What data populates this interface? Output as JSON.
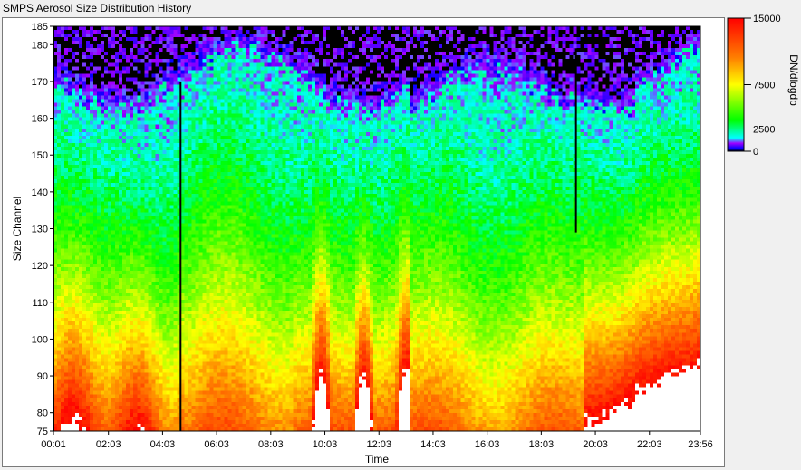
{
  "window": {
    "title": "SMPS Aerosol Size Distribution History"
  },
  "chart_data": {
    "type": "heatmap",
    "title": "SMPS Aerosol Size Distribution History",
    "xlabel": "Time",
    "ylabel": "Size Channel",
    "x_ticks": [
      "00:01",
      "02:03",
      "04:03",
      "06:03",
      "08:03",
      "10:03",
      "12:03",
      "14:03",
      "16:03",
      "18:03",
      "20:03",
      "22:03",
      "23:56"
    ],
    "y_ticks": [
      75,
      80,
      90,
      100,
      110,
      120,
      130,
      140,
      150,
      160,
      170,
      180,
      185
    ],
    "ylim": [
      75,
      185
    ],
    "colorbar": {
      "label": "DN/dlogdp",
      "ticks": [
        0,
        2500,
        7500,
        15000
      ],
      "range": [
        0,
        15000
      ],
      "stops": [
        {
          "value": 0,
          "color": "#000000"
        },
        {
          "value": 300,
          "color": "#0000ff"
        },
        {
          "value": 900,
          "color": "#a000ff"
        },
        {
          "value": 1500,
          "color": "#00ffff"
        },
        {
          "value": 3500,
          "color": "#00ff00"
        },
        {
          "value": 7500,
          "color": "#ffff00"
        },
        {
          "value": 10500,
          "color": "#ff8000"
        },
        {
          "value": 15000,
          "color": "#ff0000"
        }
      ],
      "overflow_color": "#ffffff"
    },
    "vertical_lines": [
      {
        "time": "00:01",
        "from_channel": 75,
        "to_channel": 185
      },
      {
        "time": "04:43",
        "from_channel": 75,
        "to_channel": 170
      },
      {
        "time": "19:20",
        "from_channel": 129,
        "to_channel": 179
      }
    ]
  }
}
